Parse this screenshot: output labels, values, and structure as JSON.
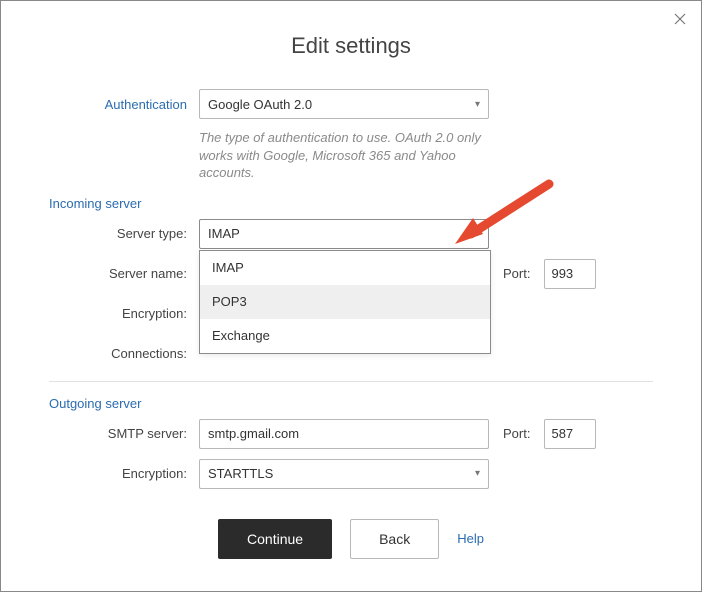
{
  "title": "Edit settings",
  "auth": {
    "label": "Authentication",
    "value": "Google OAuth 2.0",
    "hint": "The type of authentication to use. OAuth 2.0 only works with Google, Microsoft 365 and Yahoo accounts."
  },
  "incoming": {
    "section": "Incoming server",
    "server_type_label": "Server type:",
    "server_type_value": "IMAP",
    "server_name_label": "Server name:",
    "encryption_label": "Encryption:",
    "connections_label": "Connections:",
    "port_label": "Port:",
    "port_value": "993",
    "dropdown": {
      "opt0": "IMAP",
      "opt1": "POP3",
      "opt2": "Exchange"
    }
  },
  "outgoing": {
    "section": "Outgoing server",
    "smtp_label": "SMTP server:",
    "smtp_value": "smtp.gmail.com",
    "encryption_label": "Encryption:",
    "encryption_value": "STARTTLS",
    "port_label": "Port:",
    "port_value": "587"
  },
  "buttons": {
    "continue": "Continue",
    "back": "Back",
    "help": "Help"
  }
}
